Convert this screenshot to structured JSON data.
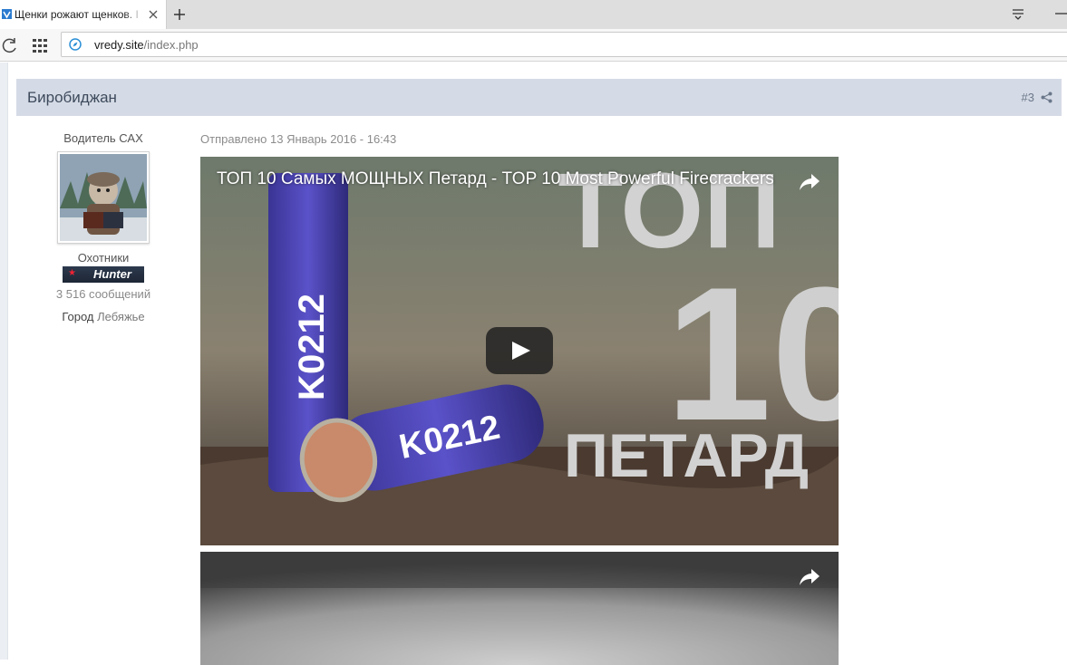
{
  "browser": {
    "tab_title": "Щенки рожают щенков. I",
    "url_domain": "vredy.site",
    "url_path": "/index.php"
  },
  "post": {
    "author": "Биробиджан",
    "post_number": "#3",
    "member_title": "Водитель САХ",
    "group": "Охотники",
    "badge_text": "Hunter",
    "post_count": "3 516 сообщений",
    "city_label": "Город",
    "city_value": "Лебяжье",
    "date": "Отправлено 13 Январь 2016 - 16:43"
  },
  "video1": {
    "title": "ТОП 10 Самых МОЩНЫХ Петард - TOP 10 Most Powerful Firecrackers",
    "thumb_big_text_1": "ТОП",
    "thumb_big_text_2": "10",
    "thumb_big_text_3": "ПЕТАРД",
    "firecracker_label": "K0212"
  },
  "colors": {
    "header_bg": "#d5dbe6",
    "youtube_play": "#212121",
    "firecracker_blue": "#4f46b8"
  }
}
